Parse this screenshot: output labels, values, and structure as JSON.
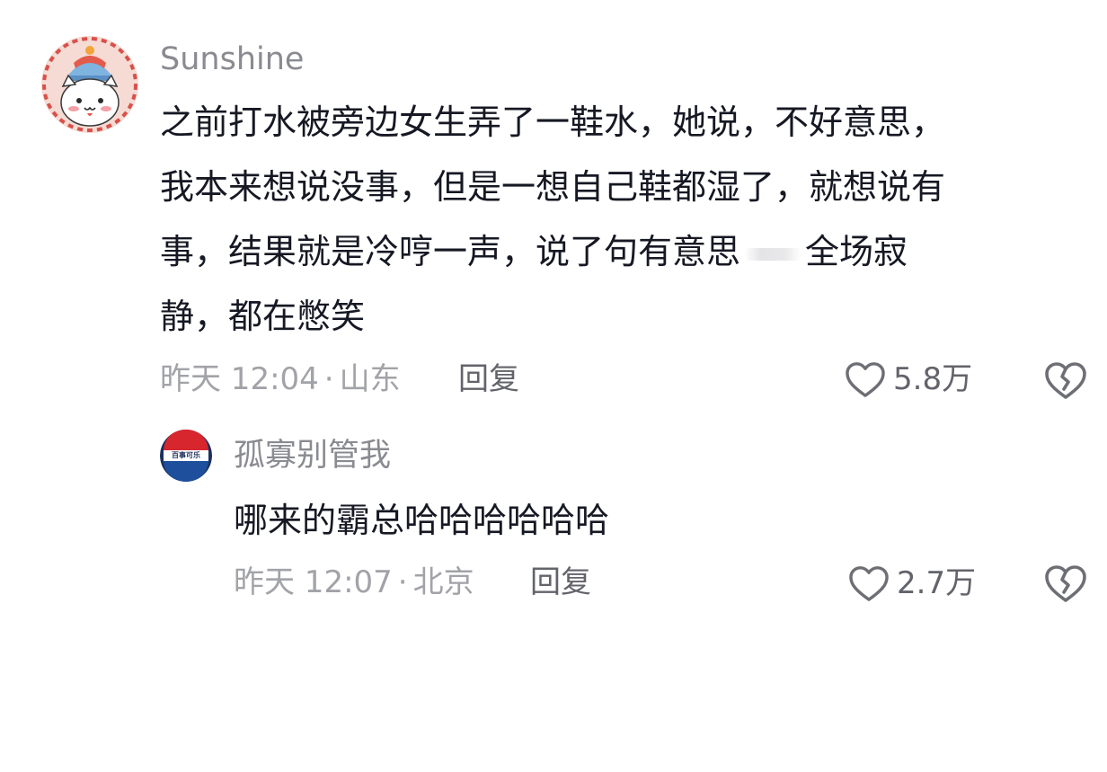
{
  "comments": [
    {
      "username": "Sunshine",
      "content_lines": [
        "之前打水被旁边女生弄了一鞋水，她说，不好意思，",
        "我本来想说没事，但是一想自己鞋都湿了，就想说有",
        "事，结果就是冷哼一声，说了句有意思",
        "全场寂",
        "静，都在憋笑"
      ],
      "time": "昨天 12:04",
      "location": "山东",
      "reply_label": "回复",
      "likes": "5.8万",
      "avatar_icon": "cartoon-cat-avatar"
    },
    {
      "username": "孤寡别管我",
      "content": "哪来的霸总哈哈哈哈哈哈",
      "time": "昨天 12:07",
      "location": "北京",
      "reply_label": "回复",
      "likes": "2.7万",
      "avatar_icon": "pepsi-logo-avatar",
      "avatar_text": "百事可乐"
    }
  ],
  "meta_separator": "·",
  "icons": {
    "like": "heart-outline-icon",
    "dislike": "broken-heart-icon"
  },
  "colors": {
    "text": "#161823",
    "username": "#8a8b91",
    "meta": "#a2a3a8",
    "action": "#63646b"
  }
}
